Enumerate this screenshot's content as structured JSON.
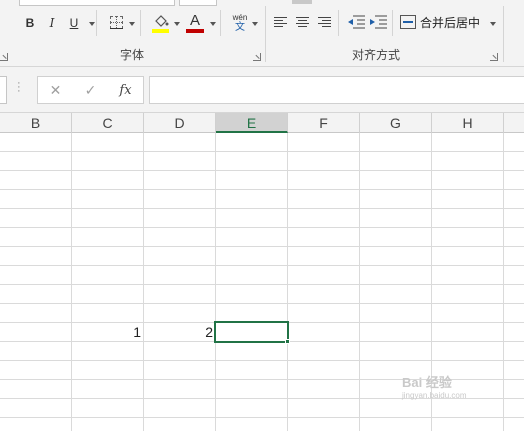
{
  "ribbon": {
    "font_group": {
      "label": "字体",
      "bold": "B",
      "italic": "I",
      "underline": "U",
      "font_color_glyph": "A",
      "phonetic_top": "wén",
      "phonetic_bottom": "文"
    },
    "alignment_group": {
      "label": "对齐方式",
      "merge_center_label": "合并后居中"
    },
    "colors": {
      "highlight": "#ffff00",
      "font_color": "#c00000"
    }
  },
  "formula_bar": {
    "cancel_icon": "✕",
    "enter_icon": "✓",
    "fx_label": "fx",
    "formula": ""
  },
  "grid": {
    "columns": [
      "B",
      "C",
      "D",
      "E",
      "F",
      "G",
      "H"
    ],
    "active_column": "E",
    "cells": {
      "C_value": "1",
      "D_value": "2",
      "E_value": ""
    }
  },
  "watermark": {
    "text": "Bai 经验",
    "sub": "jingyan.baidu.com"
  },
  "accent": "#217346"
}
